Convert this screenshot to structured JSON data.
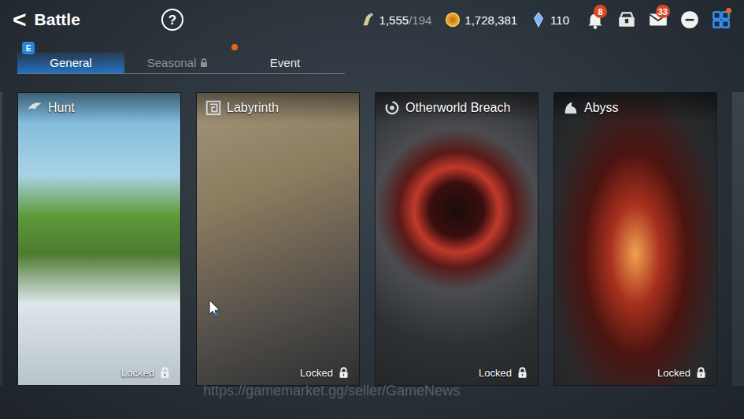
{
  "header": {
    "back": "<",
    "title": "Battle",
    "help": "?"
  },
  "resources": [
    {
      "value": "1,555",
      "max": "/194"
    },
    {
      "value": "1,728,381",
      "max": ""
    },
    {
      "value": "110",
      "max": ""
    }
  ],
  "icons": [
    {
      "kind": "bell",
      "badge": "8"
    },
    {
      "kind": "chest",
      "badge": ""
    },
    {
      "kind": "mail",
      "badge": "33"
    },
    {
      "kind": "chat",
      "badge": ""
    },
    {
      "kind": "menu",
      "badge": "",
      "dot": true
    }
  ],
  "tabs": [
    {
      "label": "General",
      "selected": true,
      "locked": false,
      "badge": "E",
      "new": false
    },
    {
      "label": "Seasonal",
      "selected": false,
      "locked": true,
      "badge": "",
      "new": false
    },
    {
      "label": "Event",
      "selected": false,
      "locked": false,
      "badge": "",
      "new": true
    }
  ],
  "cards": [
    {
      "title": "Hunt",
      "status": "Locked",
      "locked": true,
      "color": "#5f9a3a"
    },
    {
      "title": "Labyrinth",
      "status": "Locked",
      "locked": true,
      "color": "#8a7a5e"
    },
    {
      "title": "Otherworld Breach",
      "status": "Locked",
      "locked": true,
      "color": "#c0392b"
    },
    {
      "title": "Abyss",
      "status": "Locked",
      "locked": true,
      "color": "#a8301e"
    }
  ],
  "watermark": "https://gamemarket.gg/seller/GameNews"
}
